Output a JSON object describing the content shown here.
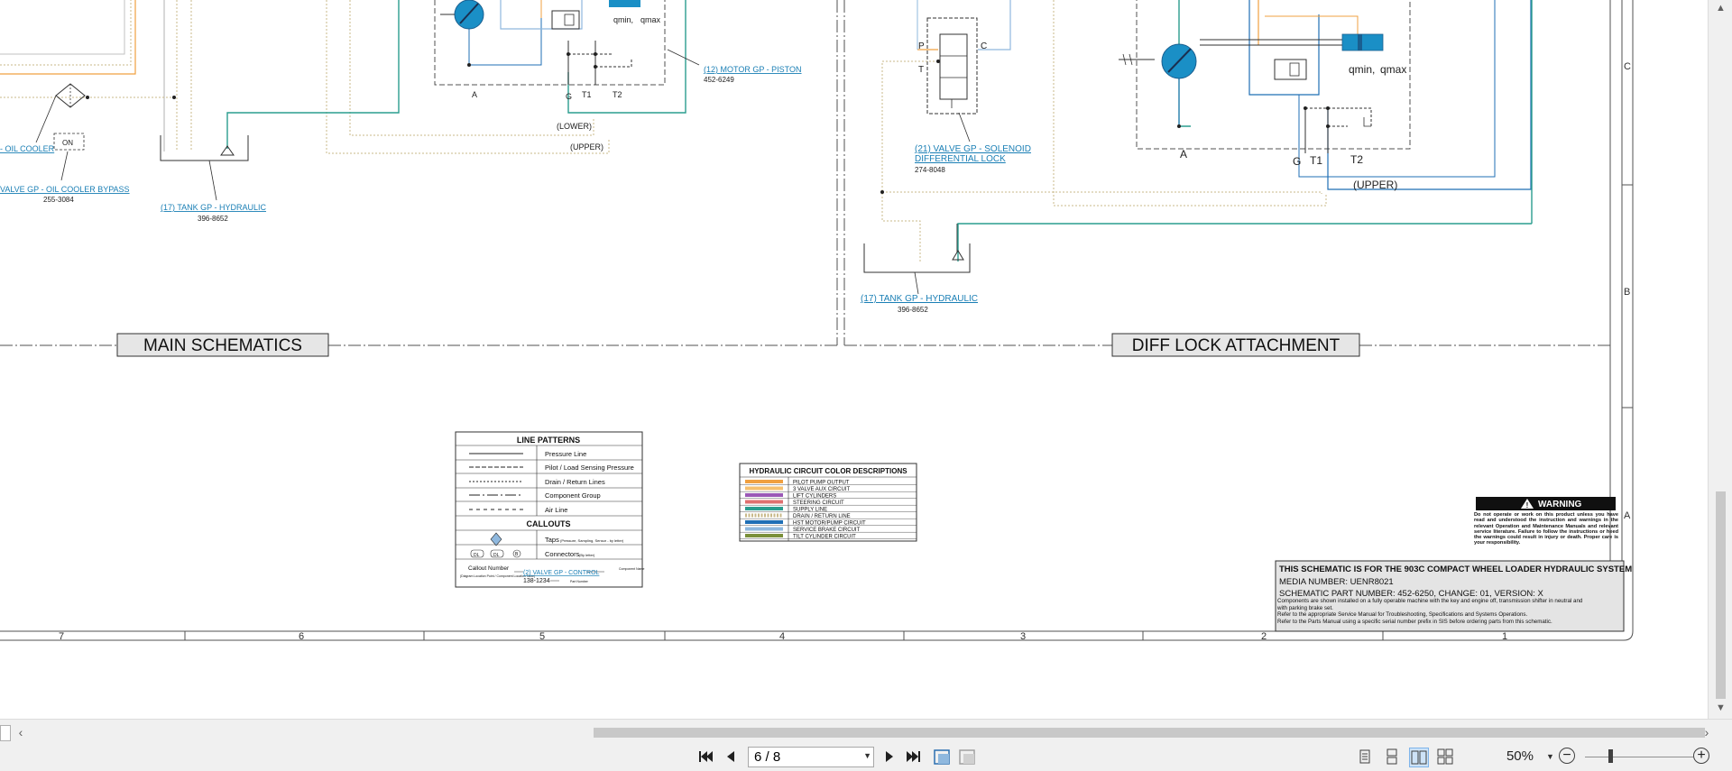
{
  "schematic": {
    "main": {
      "section_title": "MAIN SCHEMATICS",
      "oil_cooler": "- OIL COOLER",
      "bypass_valve": "VALVE GP - OIL COOLER BYPASS",
      "bypass_part": "255-3084",
      "bypass_symbol": "ON",
      "tank_label": "(17) TANK GP - HYDRAULIC",
      "tank_part": "396-8652",
      "motor_label": "(12) MOTOR GP - PISTON",
      "motor_part": "452-6249",
      "lower": "(LOWER)",
      "upper": "(UPPER)",
      "port_a": "A",
      "port_g": "G",
      "port_t1": "T1",
      "port_t2": "T2",
      "qmin": "qmin,",
      "qmax": "qmax"
    },
    "diff": {
      "section_title": "DIFF LOCK ATTACHMENT",
      "valve_label_1": "(21) VALVE GP - SOLENOID",
      "valve_label_2": "DIFFERENTIAL LOCK",
      "valve_part": "274-8048",
      "tank_label": "(17) TANK GP - HYDRAULIC",
      "tank_part": "396-8652",
      "port_p": "P",
      "port_c": "C",
      "port_t": "T",
      "port_a": "A",
      "port_g": "G",
      "port_t1": "T1",
      "port_t2": "T2",
      "upper": "(UPPER)",
      "qmin": "qmin,",
      "qmax": "qmax"
    },
    "legend_patterns": {
      "title": "LINE PATTERNS",
      "items": [
        "Pressure Line",
        "Pilot / Load Sensing Pressure",
        "Drain / Return Lines",
        "Component Group",
        "Air Line"
      ],
      "callouts_title": "CALLOUTS",
      "taps": "Taps",
      "taps_note": "(Pressure, Sampling, Sensor - by letter)",
      "connectors": "Connectors",
      "connectors_note": "(By letter)",
      "conn_a": "DL",
      "conn_b": "DL",
      "conn_c": "B",
      "callout_number": "Callout Number",
      "callout_note": "(Diagram Location Point / Component Location Table)",
      "callout_example": "(2) VALVE GP - CONTROL",
      "part_example": "138-1234",
      "component_name": "Component Name",
      "part_number": "Part Number"
    },
    "legend_colors": {
      "title": "HYDRAULIC CIRCUIT COLOR DESCRIPTIONS",
      "items": [
        {
          "label": "PILOT PUMP OUTPUT",
          "color": "#f0a040"
        },
        {
          "label": "3 VALVE AUX CIRCUIT",
          "color": "#f5c070"
        },
        {
          "label": "LIFT CYLINDERS",
          "color": "#9b59b6"
        },
        {
          "label": "STEERING CIRCUIT",
          "color": "#e07070"
        },
        {
          "label": "SUPPLY LINE",
          "color": "#2a9d8f"
        },
        {
          "label": "DRAIN / RETURN LINE",
          "color": "#c9b98a"
        },
        {
          "label": "HST MOTOR/PUMP CIRCUIT",
          "color": "#1f6fb5"
        },
        {
          "label": "SERVICE BRAKE CIRCUIT",
          "color": "#8fb8de"
        },
        {
          "label": "TILT CYLINDER CIRCUIT",
          "color": "#7a8f3a"
        }
      ]
    },
    "warning": {
      "title": "WARNING",
      "text": "Do not operate or work on this product unless you have read and understood the instruction and warnings in the relevant Operation and Maintenance Manuals and relevant service literature. Failure to follow the instructions or heed the warnings could result in injury or death. Proper care is your responsibility."
    },
    "title_block": {
      "line1": "THIS SCHEMATIC IS FOR THE 903C COMPACT WHEEL LOADER HYDRAULIC SYSTEM",
      "line2": "MEDIA NUMBER: UENR8021",
      "line3": "SCHEMATIC PART NUMBER: 452-6250, CHANGE: 01, VERSION: X",
      "line4": "Components are shown installed on a fully operable machine with the key and engine off, transmission shifter in neutral and with parking brake set.",
      "line5": "Refer to the appropriate Service Manual for Troubleshooting, Specifications and Systems Operations.",
      "line6": "Refer to the Parts Manual using a specific serial number prefix in SIS before ordering parts from this schematic."
    },
    "grid_columns": [
      "7",
      "6",
      "5",
      "4",
      "3",
      "2",
      "1"
    ],
    "grid_rows": [
      "C",
      "B",
      "A"
    ]
  },
  "toolbar": {
    "first_page": "first-page",
    "prev_page": "previous-page",
    "page_value": "6 / 8",
    "next_page": "next-page",
    "last_page": "last-page",
    "zoom_value": "50%"
  }
}
